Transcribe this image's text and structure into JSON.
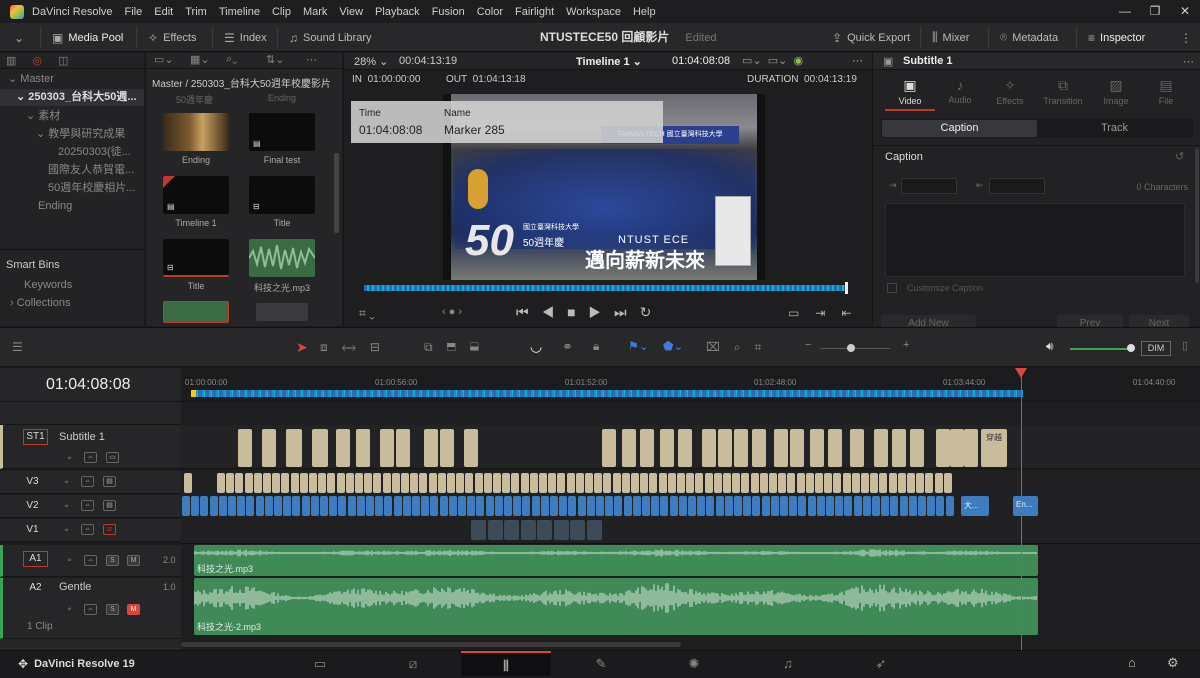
{
  "window": {
    "app_name": "DaVinci Resolve",
    "menu": [
      "File",
      "Edit",
      "Trim",
      "Timeline",
      "Clip",
      "Mark",
      "View",
      "Playback",
      "Fusion",
      "Color",
      "Fairlight",
      "Workspace",
      "Help"
    ]
  },
  "toolbar": {
    "media_pool": "Media Pool",
    "effects": "Effects",
    "index": "Index",
    "sound_library": "Sound Library",
    "project_name": "NTUSTECE50 回顧影片",
    "project_status": "Edited",
    "quick_export": "Quick Export",
    "mixer": "Mixer",
    "metadata": "Metadata",
    "inspector": "Inspector"
  },
  "media_pool": {
    "path": "Master / 250303_台科大50週年校慶影片",
    "bins": [
      {
        "label": "Master",
        "level": 0
      },
      {
        "label": "250303_台科大50週...",
        "level": 1
      },
      {
        "label": "素材",
        "level": 2
      },
      {
        "label": "教學與研究成果",
        "level": 3
      },
      {
        "label": "20250303(徒...",
        "level": 4
      },
      {
        "label": "國際友人恭賀電...",
        "level": 3
      },
      {
        "label": "50週年校慶相片...",
        "level": 3
      },
      {
        "label": "Ending",
        "level": 2
      }
    ],
    "smart_bins": "Smart Bins",
    "keywords": "Keywords",
    "collections": "Collections",
    "partial_top_labels": [
      "50週年慶",
      "Ending"
    ],
    "clips": [
      {
        "label": "Ending",
        "kind": "photo"
      },
      {
        "label": "Final test",
        "kind": "timeline"
      },
      {
        "label": "Timeline 1",
        "kind": "timeline-red"
      },
      {
        "label": "Title",
        "kind": "title"
      },
      {
        "label": "Title",
        "kind": "title-red"
      },
      {
        "label": "科技之光.mp3",
        "kind": "audio"
      }
    ]
  },
  "viewer": {
    "zoom": "28%",
    "timecode_top": "00:04:13:19",
    "timeline_name": "Timeline 1",
    "current_tc": "01:04:08:08",
    "in_label": "IN",
    "in_tc": "01:00:00:00",
    "out_label": "OUT",
    "out_tc": "01:04:13:18",
    "duration_label": "DURATION",
    "duration_tc": "00:04:13:19",
    "marker_time_label": "Time",
    "marker_time": "01:04:08:08",
    "marker_name_label": "Name",
    "marker_name": "Marker 285",
    "overlay_banner": "TAIWAN TECH 國立臺灣科技大學",
    "overlay_50": "50",
    "overlay_50_text": "50週年慶",
    "overlay_school": "國立臺灣科技大學",
    "overlay_ntust": "NTUST ECE",
    "overlay_slogan": "邁向薪新未來"
  },
  "inspector": {
    "title": "Subtitle 1",
    "tabs": [
      "Video",
      "Audio",
      "Effects",
      "Transition",
      "Image",
      "File"
    ],
    "subtabs": [
      "Caption",
      "Track"
    ],
    "section": "Caption",
    "characters": "0 Characters",
    "custom_caption": "Customize Caption",
    "add_new": "Add New",
    "prev": "Prev",
    "next": "Next"
  },
  "timeline": {
    "timecode": "01:04:08:08",
    "ruler": [
      "01:00:00:00",
      "01:00:56:00",
      "01:01:52:00",
      "01:02:48:00",
      "01:03:44:00",
      "01:04:40:00"
    ],
    "dim": "DIM",
    "tracks": {
      "st1": {
        "id": "ST1",
        "name": "Subtitle 1"
      },
      "v3": {
        "id": "V3"
      },
      "v2": {
        "id": "V2"
      },
      "v1": {
        "id": "V1"
      },
      "a1": {
        "id": "A1",
        "level": "2.0",
        "clip": "科技之光.mp3"
      },
      "a2": {
        "id": "A2",
        "name": "Gentle",
        "level": "1.0",
        "clips_count": "1 Clip",
        "clip": "科技之光-2.mp3"
      }
    },
    "subtitle_last_text": "穿越",
    "v2_labels": [
      "大...",
      "En..."
    ],
    "mute_labels": [
      "S",
      "M"
    ],
    "progress": 0.886
  },
  "bottom": {
    "brand": "DaVinci Resolve 19"
  }
}
